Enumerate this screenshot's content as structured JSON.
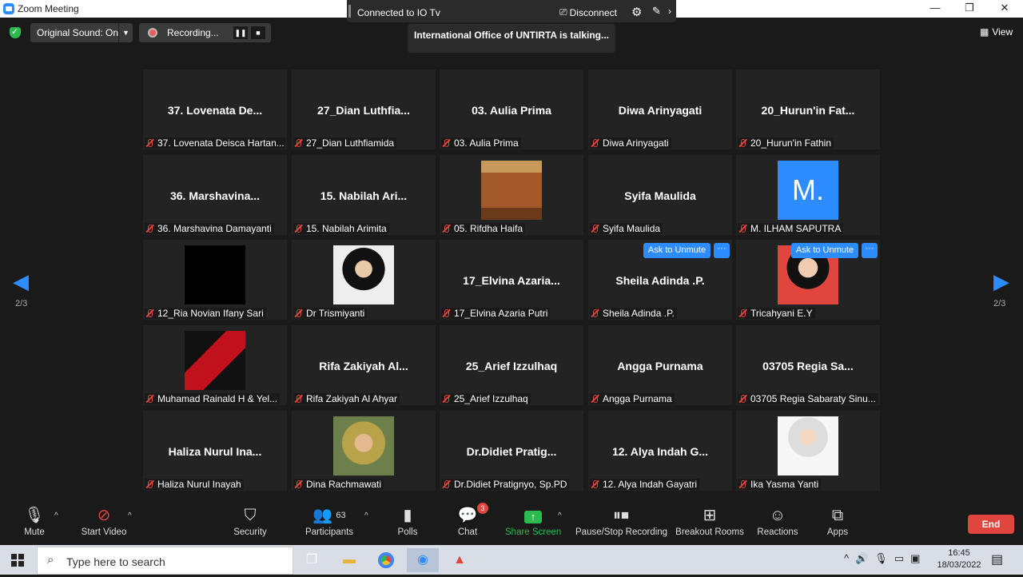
{
  "window": {
    "title": "Zoom Meeting",
    "minimize": "—",
    "restore": "❐",
    "close": "✕"
  },
  "top_control": {
    "connection": "Connected to IO Tv",
    "disconnect_label": "Disconnect"
  },
  "talking_banner": "International Office of UNTIRTA is talking...",
  "original_sound": "Original Sound: On",
  "recording": {
    "label": "Recording..."
  },
  "view_label": "View",
  "pagination": {
    "left": "2/3",
    "right": "2/3"
  },
  "ask_to_unmute": "Ask to Unmute",
  "more_dots": "···",
  "participants": [
    {
      "display": "37. Lovenata De...",
      "name": "37. Lovenata Deisca Hartan..."
    },
    {
      "display": "27_Dian Luthfia...",
      "name": "27_Dian Luthfiamida"
    },
    {
      "display": "03. Aulia Prima",
      "name": "03. Aulia Prima"
    },
    {
      "display": "Diwa Arinyagati",
      "name": "Diwa Arinyagati"
    },
    {
      "display": "20_Hurun'in Fat...",
      "name": "20_Hurun'in Fathin"
    },
    {
      "display": "36. Marshavina...",
      "name": "36. Marshavina Damayanti"
    },
    {
      "display": "15. Nabilah Ari...",
      "name": "15. Nabilah Arimita"
    },
    {
      "display": "",
      "name": "05. Rifdha Haifa",
      "video": "sofa"
    },
    {
      "display": "Syifa Maulida",
      "name": "Syifa Maulida"
    },
    {
      "display": "",
      "name": "M. ILHAM SAPUTRA",
      "video": "initial",
      "initial": "M."
    },
    {
      "display": "",
      "name": "12_Ria Novian Ifany Sari",
      "video": "black"
    },
    {
      "display": "",
      "name": "Dr Trismiyanti",
      "video": "photo1"
    },
    {
      "display": "17_Elvina Azaria...",
      "name": "17_Elvina Azaria Putri"
    },
    {
      "display": "Sheila Adinda .P.",
      "name": "Sheila Adinda .P.",
      "ask": true
    },
    {
      "display": "",
      "name": "Tricahyani E.Y",
      "video": "photo2",
      "ask": true
    },
    {
      "display": "",
      "name": "Muhamad Rainald H & Yel...",
      "video": "anime"
    },
    {
      "display": "Rifa Zakiyah Al...",
      "name": "Rifa Zakiyah Al Ahyar"
    },
    {
      "display": "25_Arief Izzulhaq",
      "name": "25_Arief Izzulhaq"
    },
    {
      "display": "Angga Purnama",
      "name": "Angga Purnama"
    },
    {
      "display": "03705 Regia Sa...",
      "name": "03705 Regia Sabaraty Sinu..."
    },
    {
      "display": "Haliza Nurul Ina...",
      "name": "Haliza Nurul Inayah"
    },
    {
      "display": "",
      "name": "Dina Rachmawati",
      "video": "photo3"
    },
    {
      "display": "Dr.Didiet Pratig...",
      "name": "Dr.Didiet Pratignyo, Sp.PD"
    },
    {
      "display": "12. Alya Indah G...",
      "name": "12. Alya Indah Gayatri"
    },
    {
      "display": "",
      "name": "Ika Yasma Yanti",
      "video": "photo4"
    }
  ],
  "toolbar": {
    "mute": "Mute",
    "start_video": "Start Video",
    "security": "Security",
    "participants": "Participants",
    "participants_count": "63",
    "polls": "Polls",
    "chat": "Chat",
    "chat_badge": "3",
    "share_screen": "Share Screen",
    "pause_stop": "Pause/Stop Recording",
    "breakout": "Breakout Rooms",
    "reactions": "Reactions",
    "apps": "Apps",
    "end": "End"
  },
  "taskbar": {
    "search_placeholder": "Type here to search",
    "time": "16:45",
    "date": "18/03/2022"
  },
  "colors": {
    "accent": "#2d8cff",
    "end": "#e0463d",
    "share": "#2dbb4f"
  }
}
